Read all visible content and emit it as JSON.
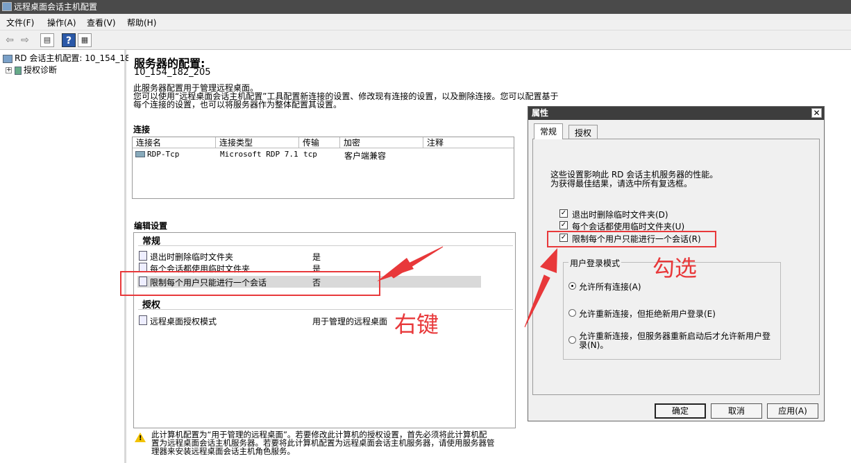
{
  "window": {
    "title": "远程桌面会话主机配置"
  },
  "menu": [
    "文件(F)",
    "操作(A)",
    "查看(V)",
    "帮助(H)"
  ],
  "toolbar": {
    "back": "⇦",
    "forward": "⇨",
    "help": "?"
  },
  "tree": {
    "root_label": "RD 会话主机配置: 10_154_18",
    "expand": "+",
    "child_label": "授权诊断"
  },
  "main": {
    "title": "服务器的配置:",
    "server": "10_154_182_205",
    "desc1": "此服务器配置用于管理远程桌面。",
    "desc2": "您可以使用“远程桌面会话主机配置”工具配置新连接的设置、修改现有连接的设置，以及删除连接。您可以配置基于",
    "desc3": "每个连接的设置，也可以将服务器作为整体配置其设置。",
    "connections": {
      "header": "连接",
      "columns": [
        "连接名",
        "连接类型",
        "传输",
        "加密",
        "注释"
      ],
      "rows": [
        {
          "name": "RDP-Tcp",
          "type": "Microsoft RDP 7.1",
          "transport": "tcp",
          "encryption": "客户端兼容",
          "comment": ""
        }
      ]
    },
    "edit": {
      "header": "编辑设置",
      "general": "常规",
      "items": [
        {
          "name": "退出时删除临时文件夹",
          "value": "是"
        },
        {
          "name": "每个会话都使用临时文件夹",
          "value": "是"
        },
        {
          "name": "限制每个用户只能进行一个会话",
          "value": "否"
        }
      ],
      "licensing": "授权",
      "lic_items": [
        {
          "name": "远程桌面授权模式",
          "value": "用于管理的远程桌面"
        }
      ]
    },
    "warning": {
      "line1": "此计算机配置为“用于管理的远程桌面”。若要修改此计算机的授权设置，首先必须将此计算机配",
      "line2": "置为远程桌面会话主机服务器。若要将此计算机配置为远程桌面会话主机服务器，请使用服务器管",
      "line3": "理器来安装远程桌面会话主机角色服务。"
    }
  },
  "dialog": {
    "title": "属性",
    "close": "✕",
    "tabs": [
      "常规",
      "授权"
    ],
    "desc1": "这些设置影响此 RD 会话主机服务器的性能。",
    "desc2": "为获得最佳结果，请选中所有复选框。",
    "checkboxes": [
      {
        "label": "退出时删除临时文件夹(D)",
        "checked": true,
        "mark": "✓"
      },
      {
        "label": "每个会话都使用临时文件夹(U)",
        "checked": true,
        "mark": "✓"
      },
      {
        "label": "限制每个用户只能进行一个会话(R)",
        "checked": true,
        "mark": "✓"
      }
    ],
    "group_label": "用户登录模式",
    "radios": [
      {
        "label": "允许所有连接(A)",
        "selected": true
      },
      {
        "label": "允许重新连接，但拒绝新用户登录(E)",
        "selected": false
      },
      {
        "label1": "允许重新连接，但服务器重新启动后才允许新用户登",
        "label2": "录(N)。",
        "selected": false
      }
    ],
    "buttons": {
      "ok": "确定",
      "cancel": "取消",
      "apply": "应用(A)"
    }
  },
  "annotations": {
    "right_click": "右键",
    "check": "勾选",
    "color": "#e8383a"
  }
}
